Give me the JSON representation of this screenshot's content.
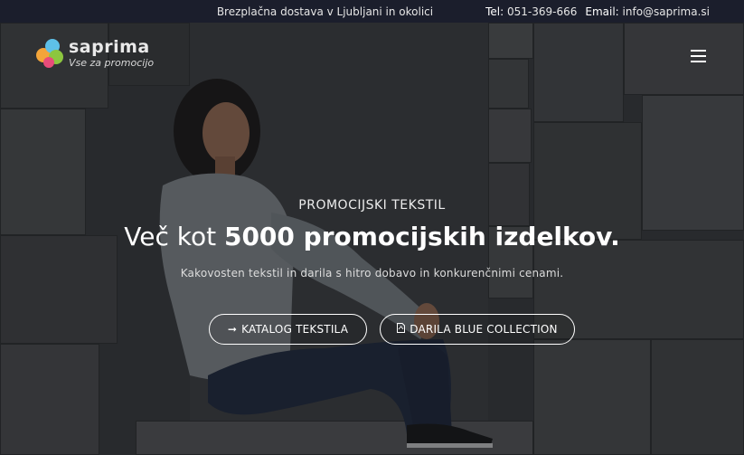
{
  "topbar": {
    "delivery": "Brezplačna dostava v Ljubljani in okolici",
    "phone_label": "Tel:",
    "phone": "051-369-666",
    "email_label": "Email:",
    "email": "info@saprima.si"
  },
  "logo": {
    "name": "saprima",
    "tagline": "Vse za promocijo",
    "colors": [
      "#f3a53a",
      "#5ec0e8",
      "#8cc63f",
      "#e84c7a"
    ]
  },
  "hero": {
    "eyebrow": "PROMOCIJSKI TEKSTIL",
    "headline_light": "Več kot ",
    "headline_bold": "5000 promocijskih izdelkov.",
    "subtitle": "Kakovosten tekstil in darila s hitro dobavo in konkurenčnimi cenami.",
    "buttons": [
      {
        "label": "KATALOG TEKSTILA",
        "icon": "arrow-right-icon"
      },
      {
        "label": "DARILA BLUE COLLECTION",
        "icon": "pdf-file-icon"
      }
    ]
  },
  "nav": {
    "menu_icon": "hamburger-menu-icon"
  }
}
